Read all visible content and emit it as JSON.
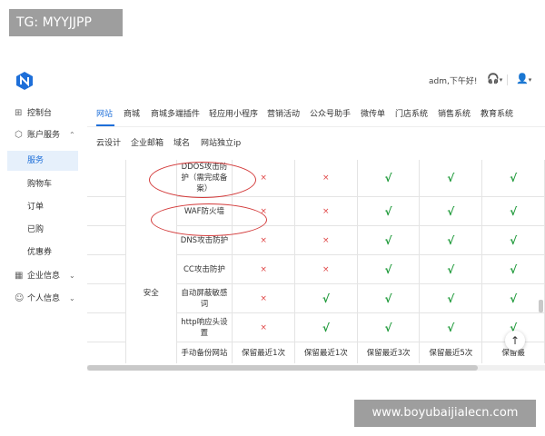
{
  "watermarks": {
    "top": "TG: MYYJJPP",
    "bottom": "www.boyubaijialecn.com"
  },
  "header": {
    "greeting": "adm,下午好!",
    "icons": [
      "headset-icon",
      "user-icon"
    ]
  },
  "sidebar": {
    "items": [
      {
        "label": "控制台",
        "icon": "dashboard-icon"
      },
      {
        "label": "账户服务",
        "icon": "box-icon",
        "expanded": true
      },
      {
        "label": "企业信息",
        "icon": "building-icon"
      },
      {
        "label": "个人信息",
        "icon": "person-icon"
      }
    ],
    "account_sub": [
      "服务",
      "购物车",
      "订单",
      "已购",
      "优惠券"
    ]
  },
  "tabs": [
    "网站",
    "商城",
    "商城多端插件",
    "轻应用小程序",
    "营销活动",
    "公众号助手",
    "微传单",
    "门店系统",
    "销售系统",
    "教育系统"
  ],
  "subtabs": [
    "云设计",
    "企业邮箱",
    "域名",
    "网站独立ip"
  ],
  "table": {
    "category": "安全",
    "rows": [
      {
        "feature": "DDOS攻击防护（需完成备案）",
        "cells": [
          "×",
          "×",
          "√",
          "√",
          "√"
        ]
      },
      {
        "feature": "WAF防火墙",
        "cells": [
          "×",
          "×",
          "√",
          "√",
          "√"
        ]
      },
      {
        "feature": "DNS攻击防护",
        "cells": [
          "×",
          "×",
          "√",
          "√",
          "√"
        ]
      },
      {
        "feature": "CC攻击防护",
        "cells": [
          "×",
          "×",
          "√",
          "√",
          "√"
        ]
      },
      {
        "feature": "自动屏蔽敏感词",
        "cells": [
          "×",
          "√",
          "√",
          "√",
          "√"
        ]
      },
      {
        "feature": "http响应头设置",
        "cells": [
          "×",
          "√",
          "√",
          "√",
          "√"
        ]
      },
      {
        "feature": "手动备份网站",
        "cells": [
          "保留最近1次",
          "保留最近1次",
          "保留最近3次",
          "保留最近5次",
          "保留最"
        ]
      }
    ]
  },
  "colors": {
    "accent": "#1e6fd9",
    "check": "#1f9a3a",
    "cross": "#e04646",
    "annotation": "#d33a3a"
  }
}
